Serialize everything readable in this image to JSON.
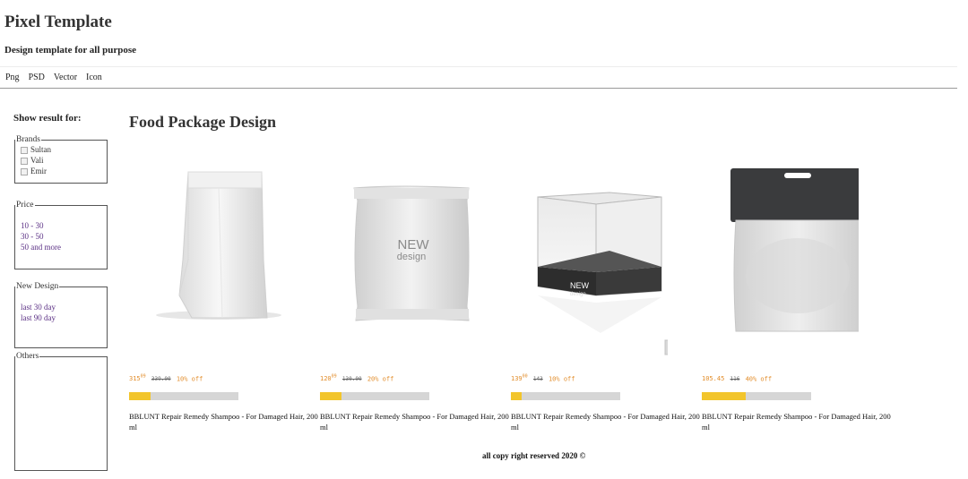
{
  "site": {
    "title": "Pixel Template",
    "subtitle": "Design template for all purpose"
  },
  "nav": [
    "Png",
    "PSD",
    "Vector",
    "Icon"
  ],
  "sidebar": {
    "heading": "Show result for:",
    "brands": {
      "legend": "Brands",
      "items": [
        "Sultan",
        "Vali",
        "Emir"
      ]
    },
    "price": {
      "legend": "Price",
      "items": [
        "10 - 30",
        "30 - 50",
        "50 and more"
      ]
    },
    "new_design": {
      "legend": "New Design",
      "items": [
        "last 30 day",
        "last 90 day"
      ]
    },
    "others": {
      "legend": "Others"
    }
  },
  "main": {
    "title": "Food Package Design",
    "products": [
      {
        "image": "stand-up-pouch-image",
        "price": "315",
        "price_sup": "09",
        "old_price": "339.00",
        "discount": "10% off",
        "progress": 0.2,
        "name": "BBLUNT Repair Remedy Shampoo - For Damaged Hair, 200 ml"
      },
      {
        "image": "pillow-pack-image",
        "image_label1": "NEW",
        "image_label2": "design",
        "price": "120",
        "price_sup": "09",
        "old_price": "130.00",
        "discount": "20% off",
        "progress": 0.2,
        "name": "BBLUNT Repair Remedy Shampoo - For Damaged Hair, 200 ml"
      },
      {
        "image": "clear-box-image",
        "image_label1": "NEW",
        "image_label2": "design",
        "price": "139",
        "price_sup": "00",
        "old_price": "143",
        "discount": "10% off",
        "progress": 0.1,
        "name": "BBLUNT Repair Remedy Shampoo - For Damaged Hair, 200 ml"
      },
      {
        "image": "hanging-bag-image",
        "price": "105.45",
        "price_sup": "",
        "old_price": "116",
        "discount": "40% off",
        "progress": 0.4,
        "name": "BBLUNT Repair Remedy Shampoo - For Damaged Hair, 200 ml"
      }
    ]
  },
  "footer": "all copy right reserved 2020 ©",
  "colors": {
    "price": "#e28d2b",
    "progress_fill": "#f2c52c",
    "progress_track": "#d6d6d6",
    "link": "#5a2f84"
  }
}
